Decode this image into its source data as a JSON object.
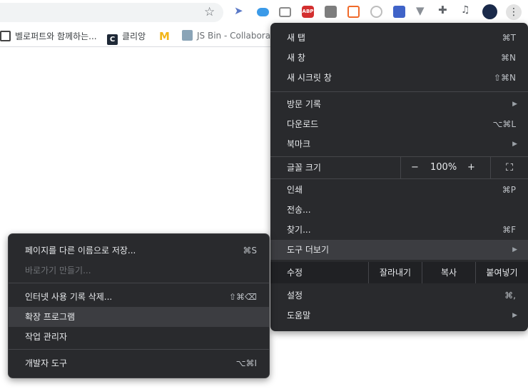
{
  "toolbar": {
    "star_icon": "star-icon",
    "extensions": [
      {
        "name": "telegram-ext-icon",
        "color": "#5b79c7"
      },
      {
        "name": "icloud-ext-icon",
        "color": "#3b9ae8"
      },
      {
        "name": "tab-manager-ext-icon",
        "color": "#8a8a8a"
      },
      {
        "name": "adblock-plus-ext-icon",
        "color": "#d32f2f"
      },
      {
        "name": "avatar-ext-icon",
        "color": "#7d7d7d"
      },
      {
        "name": "layout-ext-icon",
        "color": "#f06a2a"
      },
      {
        "name": "record-ext-icon",
        "color": "#bdbdbd"
      },
      {
        "name": "blue-ext-icon",
        "color": "#3f63c8"
      },
      {
        "name": "vue-devtools-ext-icon",
        "color": "#8a8f96"
      },
      {
        "name": "puzzle-ext-icon",
        "color": "#5f6368"
      },
      {
        "name": "media-icon",
        "color": "#5f6368"
      },
      {
        "name": "profile-avatar-icon",
        "color": "#1a2a4a"
      }
    ]
  },
  "bookmarks": [
    {
      "label": "벨로퍼트와 함께하는...",
      "icon": "book-icon",
      "color": "#444"
    },
    {
      "label": "클리앙",
      "icon": "clien-icon",
      "color": "#1f2937"
    },
    {
      "label": "",
      "icon": "mcdonalds-icon",
      "color": "#f2b619"
    },
    {
      "label": "JS Bin - Collabora",
      "icon": "jsbin-icon",
      "color": "#8aa4b7"
    }
  ],
  "main_menu": {
    "items": [
      {
        "label": "새 탭",
        "shortcut": "⌘T"
      },
      {
        "label": "새 창",
        "shortcut": "⌘N"
      },
      {
        "label": "새 시크릿 창",
        "shortcut": "⇧⌘N"
      },
      {
        "label": "방문 기록",
        "arrow": "▶"
      },
      {
        "label": "다운로드",
        "shortcut": "⌥⌘L"
      },
      {
        "label": "북마크",
        "arrow": "▶"
      },
      {
        "label": "인쇄",
        "shortcut": "⌘P"
      },
      {
        "label": "전송..."
      },
      {
        "label": "찾기...",
        "shortcut": "⌘F"
      },
      {
        "label": "도구 더보기",
        "arrow": "▶"
      },
      {
        "label": "설정",
        "shortcut": "⌘,"
      },
      {
        "label": "도움말",
        "arrow": "▶"
      }
    ],
    "zoom": {
      "label": "글꼴 크기",
      "minus": "−",
      "value": "100%",
      "plus": "+",
      "fullscreen": "⛶"
    },
    "edit": {
      "label": "수정",
      "cut": "잘라내기",
      "copy": "복사",
      "paste": "붙여넣기"
    }
  },
  "sub_menu": {
    "items": [
      {
        "label": "페이지를 다른 이름으로 저장...",
        "shortcut": "⌘S"
      },
      {
        "label": "바로가기 만들기..."
      },
      {
        "label": "인터넷 사용 기록 삭제...",
        "shortcut": "⇧⌘⌫"
      },
      {
        "label": "확장 프로그램"
      },
      {
        "label": "작업 관리자"
      },
      {
        "label": "개발자 도구",
        "shortcut": "⌥⌘I"
      }
    ]
  }
}
